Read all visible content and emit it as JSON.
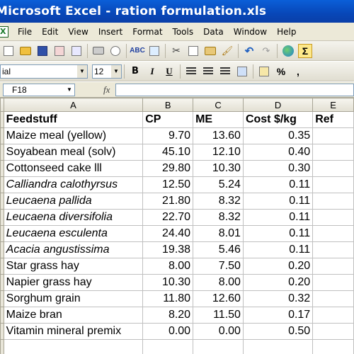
{
  "window": {
    "title": "Microsoft Excel - ration formulation.xls"
  },
  "menu": [
    "File",
    "Edit",
    "View",
    "Insert",
    "Format",
    "Tools",
    "Data",
    "Window",
    "Help"
  ],
  "formatting": {
    "font": "ial",
    "size": "12",
    "bold": "B",
    "italic": "I",
    "underline": "U",
    "percent": "%",
    "comma": ","
  },
  "formula_bar": {
    "cell_ref": "F18",
    "fx": "fx",
    "content": ""
  },
  "columns": [
    "A",
    "B",
    "C",
    "D",
    "E"
  ],
  "header": [
    "Feedstuff",
    "CP",
    "ME",
    "Cost $/kg",
    "Ref"
  ],
  "rows": [
    {
      "feed": "Maize meal (yellow)",
      "cp": "9.70",
      "me": "13.60",
      "cost": "0.35",
      "italic": false
    },
    {
      "feed": "Soyabean meal (solv)",
      "cp": "45.10",
      "me": "12.10",
      "cost": "0.40",
      "italic": false
    },
    {
      "feed": "Cottonseed cake lll",
      "cp": "29.80",
      "me": "10.30",
      "cost": "0.30",
      "italic": false
    },
    {
      "feed": "Calliandra calothyrsus",
      "cp": "12.50",
      "me": "5.24",
      "cost": "0.11",
      "italic": true
    },
    {
      "feed": "Leucaena pallida",
      "cp": "21.80",
      "me": "8.32",
      "cost": "0.11",
      "italic": true
    },
    {
      "feed": "Leucaena diversifolia",
      "cp": "22.70",
      "me": "8.32",
      "cost": "0.11",
      "italic": true
    },
    {
      "feed": "Leucaena esculenta",
      "cp": "24.40",
      "me": "8.01",
      "cost": "0.11",
      "italic": true
    },
    {
      "feed": "Acacia angustissima",
      "cp": "19.38",
      "me": "5.46",
      "cost": "0.11",
      "italic": true
    },
    {
      "feed": "Star grass hay",
      "cp": "8.00",
      "me": "7.50",
      "cost": "0.20",
      "italic": false
    },
    {
      "feed": "Napier grass hay",
      "cp": "10.30",
      "me": "8.00",
      "cost": "0.20",
      "italic": false
    },
    {
      "feed": "Sorghum grain",
      "cp": "11.80",
      "me": "12.60",
      "cost": "0.32",
      "italic": false
    },
    {
      "feed": "Maize bran",
      "cp": "8.20",
      "me": "11.50",
      "cost": "0.17",
      "italic": false
    },
    {
      "feed": "Vitamin mineral premix",
      "cp": "0.00",
      "me": "0.00",
      "cost": "0.50",
      "italic": false
    }
  ],
  "colors": {
    "titlebar": "#0a53c8",
    "chrome": "#ece9d8",
    "gridline": "#c0c0c0"
  }
}
